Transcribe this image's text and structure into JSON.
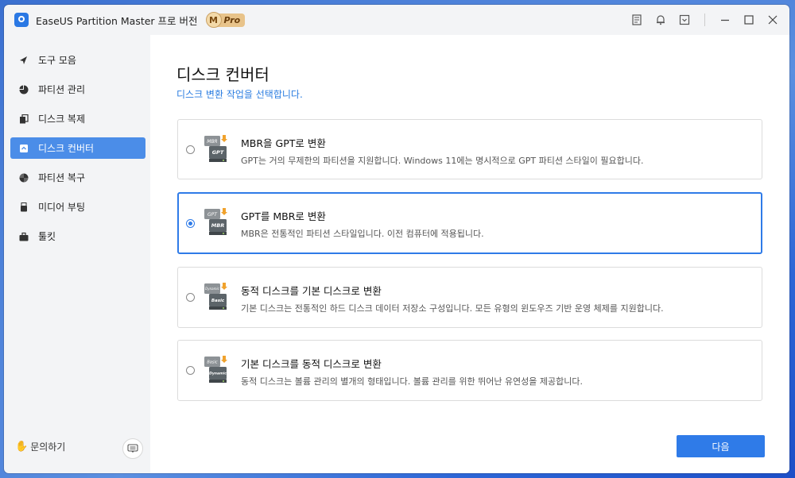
{
  "app": {
    "title": "EaseUS Partition Master 프로 버전",
    "pro_letter": "M",
    "pro_label": "Pro"
  },
  "titlebar_icons": [
    "notes-icon",
    "bell-icon",
    "dropdown-box-icon",
    "minimize-icon",
    "maximize-icon",
    "close-icon"
  ],
  "sidebar": {
    "items": [
      {
        "label": "도구 모음",
        "icon": "compass-icon"
      },
      {
        "label": "파티션 관리",
        "icon": "pie-icon"
      },
      {
        "label": "디스크 복제",
        "icon": "copy-icon"
      },
      {
        "label": "디스크 컨버터",
        "icon": "convert-icon",
        "active": true
      },
      {
        "label": "파티션 복구",
        "icon": "recovery-icon"
      },
      {
        "label": "미디어 부팅",
        "icon": "usb-icon"
      },
      {
        "label": "툴킷",
        "icon": "toolkit-icon"
      }
    ],
    "help_label": "문의하기"
  },
  "main": {
    "title": "디스크 컨버터",
    "subtitle": "디스크 변환 작업을 선택합니다.",
    "options": [
      {
        "title": "MBR을 GPT로 변환",
        "desc": "GPT는 거의 무제한의 파티션을 지원합니다. Windows 11에는 명시적으로 GPT 파티션 스타일이 필요합니다.",
        "selected": false,
        "icon_top": "MBR",
        "icon_bottom": "GPT"
      },
      {
        "title": "GPT를 MBR로 변환",
        "desc": "MBR은 전통적인 파티션 스타일입니다. 이전 컴퓨터에 적용됩니다.",
        "selected": true,
        "icon_top": "GPT",
        "icon_bottom": "MBR"
      },
      {
        "title": "동적 디스크를 기본 디스크로 변환",
        "desc": "기본 디스크는 전통적인 하드 디스크 데이터 저장소 구성입니다. 모든 유형의 윈도우즈 기반 운영 체제를 지원합니다.",
        "selected": false,
        "icon_top": "Dynamic",
        "icon_bottom": "Basic"
      },
      {
        "title": "기본 디스크를 동적 디스크로 변환",
        "desc": "동적 디스크는 볼륨 관리의 별개의 형태입니다. 볼륨 관리를 위한 뛰어난 유연성을 제공합니다.",
        "selected": false,
        "icon_top": "Basic",
        "icon_bottom": "Dynamic"
      }
    ],
    "next_label": "다음"
  },
  "colors": {
    "accent": "#2f7be8",
    "active_nav": "#4b8de8",
    "subtitle": "#2b7de0"
  }
}
